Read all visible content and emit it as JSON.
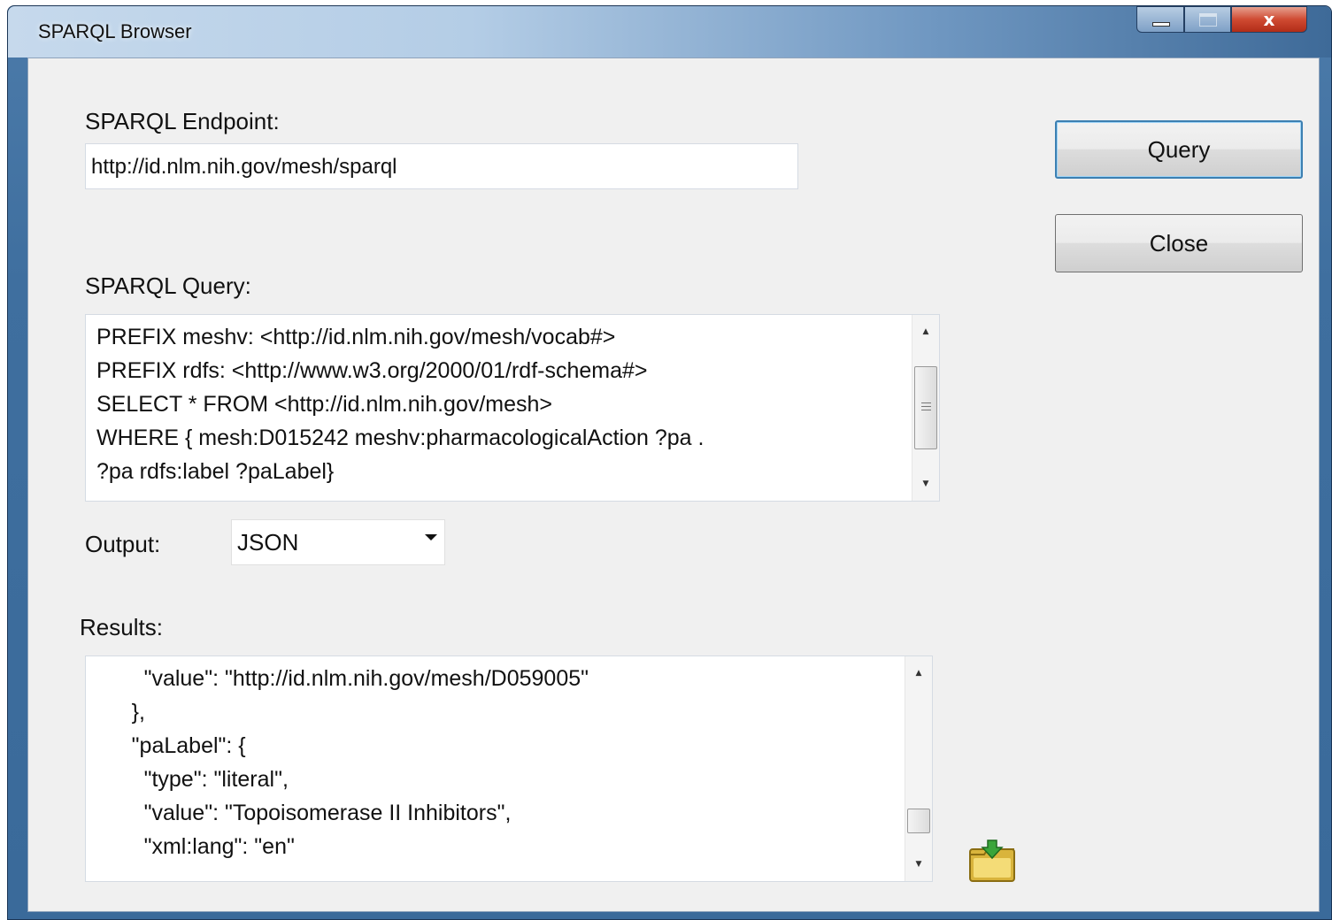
{
  "window": {
    "title": "SPARQL Browser",
    "controls": {
      "minimize": "minimize",
      "maximize": "maximize",
      "close": "x"
    }
  },
  "endpoint": {
    "label": "SPARQL Endpoint:",
    "value": "http://id.nlm.nih.gov/mesh/sparql"
  },
  "query": {
    "label": "SPARQL Query:",
    "lines": [
      "PREFIX meshv: <http://id.nlm.nih.gov/mesh/vocab#>",
      "PREFIX rdfs: <http://www.w3.org/2000/01/rdf-schema#>",
      "SELECT * FROM <http://id.nlm.nih.gov/mesh>",
      "WHERE { mesh:D015242 meshv:pharmacologicalAction ?pa .",
      "?pa rdfs:label ?paLabel}"
    ]
  },
  "output": {
    "label": "Output:",
    "selected": "JSON"
  },
  "results": {
    "label": "Results:",
    "lines": [
      "        \"value\": \"http://id.nlm.nih.gov/mesh/D059005\"",
      "      },",
      "      \"paLabel\": {",
      "        \"type\": \"literal\",",
      "        \"value\": \"Topoisomerase II Inhibitors\",",
      "        \"xml:lang\": \"en\""
    ]
  },
  "buttons": {
    "query": "Query",
    "close": "Close"
  },
  "icons": {
    "save": "save-folder-icon"
  },
  "colors": {
    "default_button_border": "#3c7fb1",
    "close_control": "#cf4a32"
  }
}
